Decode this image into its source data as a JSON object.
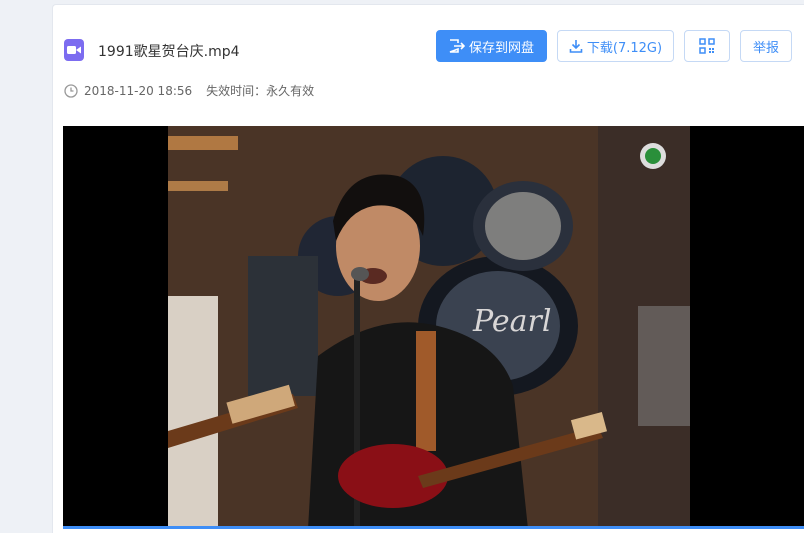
{
  "file": {
    "name": "1991歌星贺台庆.mp4",
    "icon": "video-file-icon",
    "created": "2018-11-20 18:56",
    "expiry": "失效时间：永久有效"
  },
  "actions": {
    "save_label": "保存到网盘",
    "download_label": "下载(7.12G)",
    "report_label": "举报",
    "qr_icon": "qr-code-icon"
  },
  "player": {
    "content": "live concert video frame",
    "progress": 1.0
  },
  "colors": {
    "accent": "#3e8ef7",
    "file_icon": "#7c6cf0",
    "background": "#eef1f6"
  }
}
